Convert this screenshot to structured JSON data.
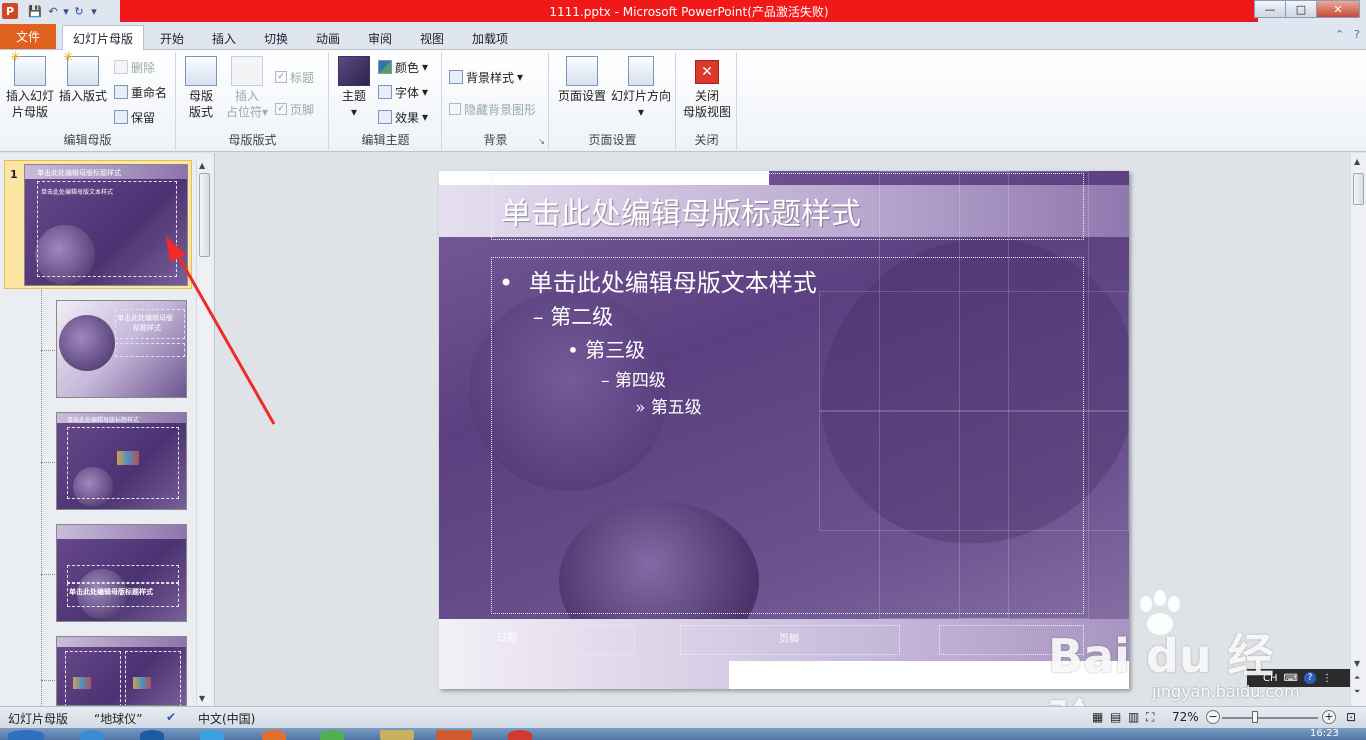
{
  "window": {
    "title": "1111.pptx - Microsoft PowerPoint(产品激活失败)",
    "controls": {
      "minimize": "—",
      "maximize": "□",
      "close": "✕"
    }
  },
  "tabs": [
    "文件",
    "幻灯片母版",
    "开始",
    "插入",
    "切换",
    "动画",
    "审阅",
    "视图",
    "加载项"
  ],
  "ribbon": {
    "edit_master": {
      "label": "编辑母版",
      "insert_slide_master": "插入幻灯片母版",
      "insert_slide_master_l1": "插入幻灯",
      "insert_slide_master_l2": "片母版",
      "insert_layout": "插入版式",
      "delete": "删除",
      "rename": "重命名",
      "preserve": "保留"
    },
    "master_layout": {
      "label": "母版版式",
      "master_layout_l1": "母版",
      "master_layout_l2": "版式",
      "insert_placeholder_l1": "插入",
      "insert_placeholder_l2": "占位符",
      "title_chk": "标题",
      "footer_chk": "页脚"
    },
    "edit_theme": {
      "label": "编辑主题",
      "themes": "主题",
      "colors": "颜色",
      "fonts": "字体",
      "effects": "效果"
    },
    "background": {
      "label": "背景",
      "bg_styles": "背景样式",
      "hide_bg": "隐藏背景图形"
    },
    "page_setup": {
      "label": "页面设置",
      "page_setup": "页面设置",
      "orientation": "幻灯片方向"
    },
    "close": {
      "label": "关闭",
      "close_l1": "关闭",
      "close_l2": "母版视图"
    }
  },
  "thumbnails": {
    "first_number": "1",
    "t1_title": "单击此处编辑母版标题样式",
    "t1_body": "单击此处编辑母版文本样式",
    "t2_title_l1": "单击此处编辑母版",
    "t2_title_l2": "标题样式",
    "t3_title": "单击此处编辑母版标题样式",
    "t4_title": "单击此处编辑母版标题样式"
  },
  "slide": {
    "title": "单击此处编辑母版标题样式",
    "level1": "单击此处编辑母版文本样式",
    "level2": "第二级",
    "level3": "第三级",
    "level4": "第四级",
    "level5": "第五级",
    "bullet1": "•",
    "bullet2": "–",
    "bullet3": "•",
    "bullet4": "–",
    "bullet5": "»",
    "footer_date": "日期",
    "footer": "页脚"
  },
  "statusbar": {
    "view": "幻灯片母版",
    "theme": "“地球仪”",
    "language": "中文(中国)",
    "zoom": "72%",
    "time": "16:23"
  },
  "ime": {
    "label": "CH"
  },
  "watermark": {
    "brand": "Bai  du 经验",
    "url": "jingyan.baidu.com"
  },
  "colors": {
    "title_red": "#f01818",
    "file_tab": "#e0601e",
    "slide_purple": "#5b3f80"
  }
}
